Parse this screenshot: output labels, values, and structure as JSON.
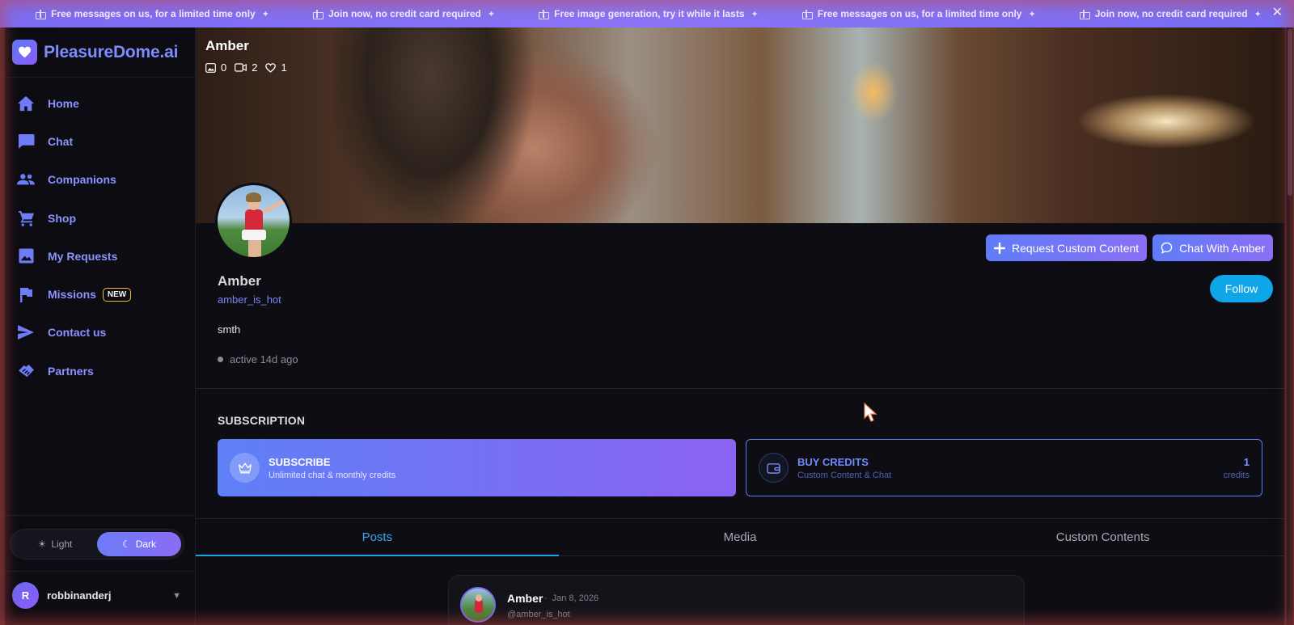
{
  "banner": {
    "items": [
      "Free messages on us, for a limited time only",
      "Join now, no credit card required",
      "Free image generation, try it while it lasts",
      "Free messages on us, for a limited time only",
      "Join now, no credit card required"
    ],
    "close_icon": "close-icon"
  },
  "sidebar": {
    "brand": "PleasureDome.ai",
    "items": [
      {
        "label": "Home",
        "icon": "home-icon"
      },
      {
        "label": "Chat",
        "icon": "chat-icon"
      },
      {
        "label": "Companions",
        "icon": "people-icon"
      },
      {
        "label": "Shop",
        "icon": "cart-icon"
      },
      {
        "label": "My Requests",
        "icon": "image-icon"
      },
      {
        "label": "Missions",
        "icon": "flag-icon",
        "badge": "NEW"
      },
      {
        "label": "Contact us",
        "icon": "send-icon"
      },
      {
        "label": "Partners",
        "icon": "handshake-icon"
      }
    ],
    "theme": {
      "light": "Light",
      "dark": "Dark",
      "selected": "Dark"
    },
    "user": {
      "initial": "R",
      "name": "robbinanderj"
    }
  },
  "profile": {
    "cover_title": "Amber",
    "stats": {
      "images": "0",
      "videos": "2",
      "likes": "1"
    },
    "name": "Amber",
    "handle": "amber_is_hot",
    "bio": "smth",
    "active": "active 14d ago",
    "buttons": {
      "request": "Request Custom Content",
      "chat": "Chat With Amber",
      "follow": "Follow"
    }
  },
  "subscription": {
    "title": "SUBSCRIPTION",
    "subscribe": {
      "title": "SUBSCRIBE",
      "subtitle": "Unlimited chat & monthly credits"
    },
    "buy": {
      "title": "BUY CREDITS",
      "subtitle": "Custom Content & Chat",
      "count": "1",
      "unit": "credits"
    }
  },
  "tabs": [
    {
      "label": "Posts",
      "active": true
    },
    {
      "label": "Media",
      "active": false
    },
    {
      "label": "Custom Contents",
      "active": false
    }
  ],
  "post": {
    "name": "Amber",
    "date": "Jan 8, 2026",
    "handle": "@amber_is_hot"
  },
  "colors": {
    "accent": "#7c8cff",
    "follow": "#0ea5e9",
    "tab_active": "#38a9e8",
    "badge_border": "#f2b935"
  }
}
